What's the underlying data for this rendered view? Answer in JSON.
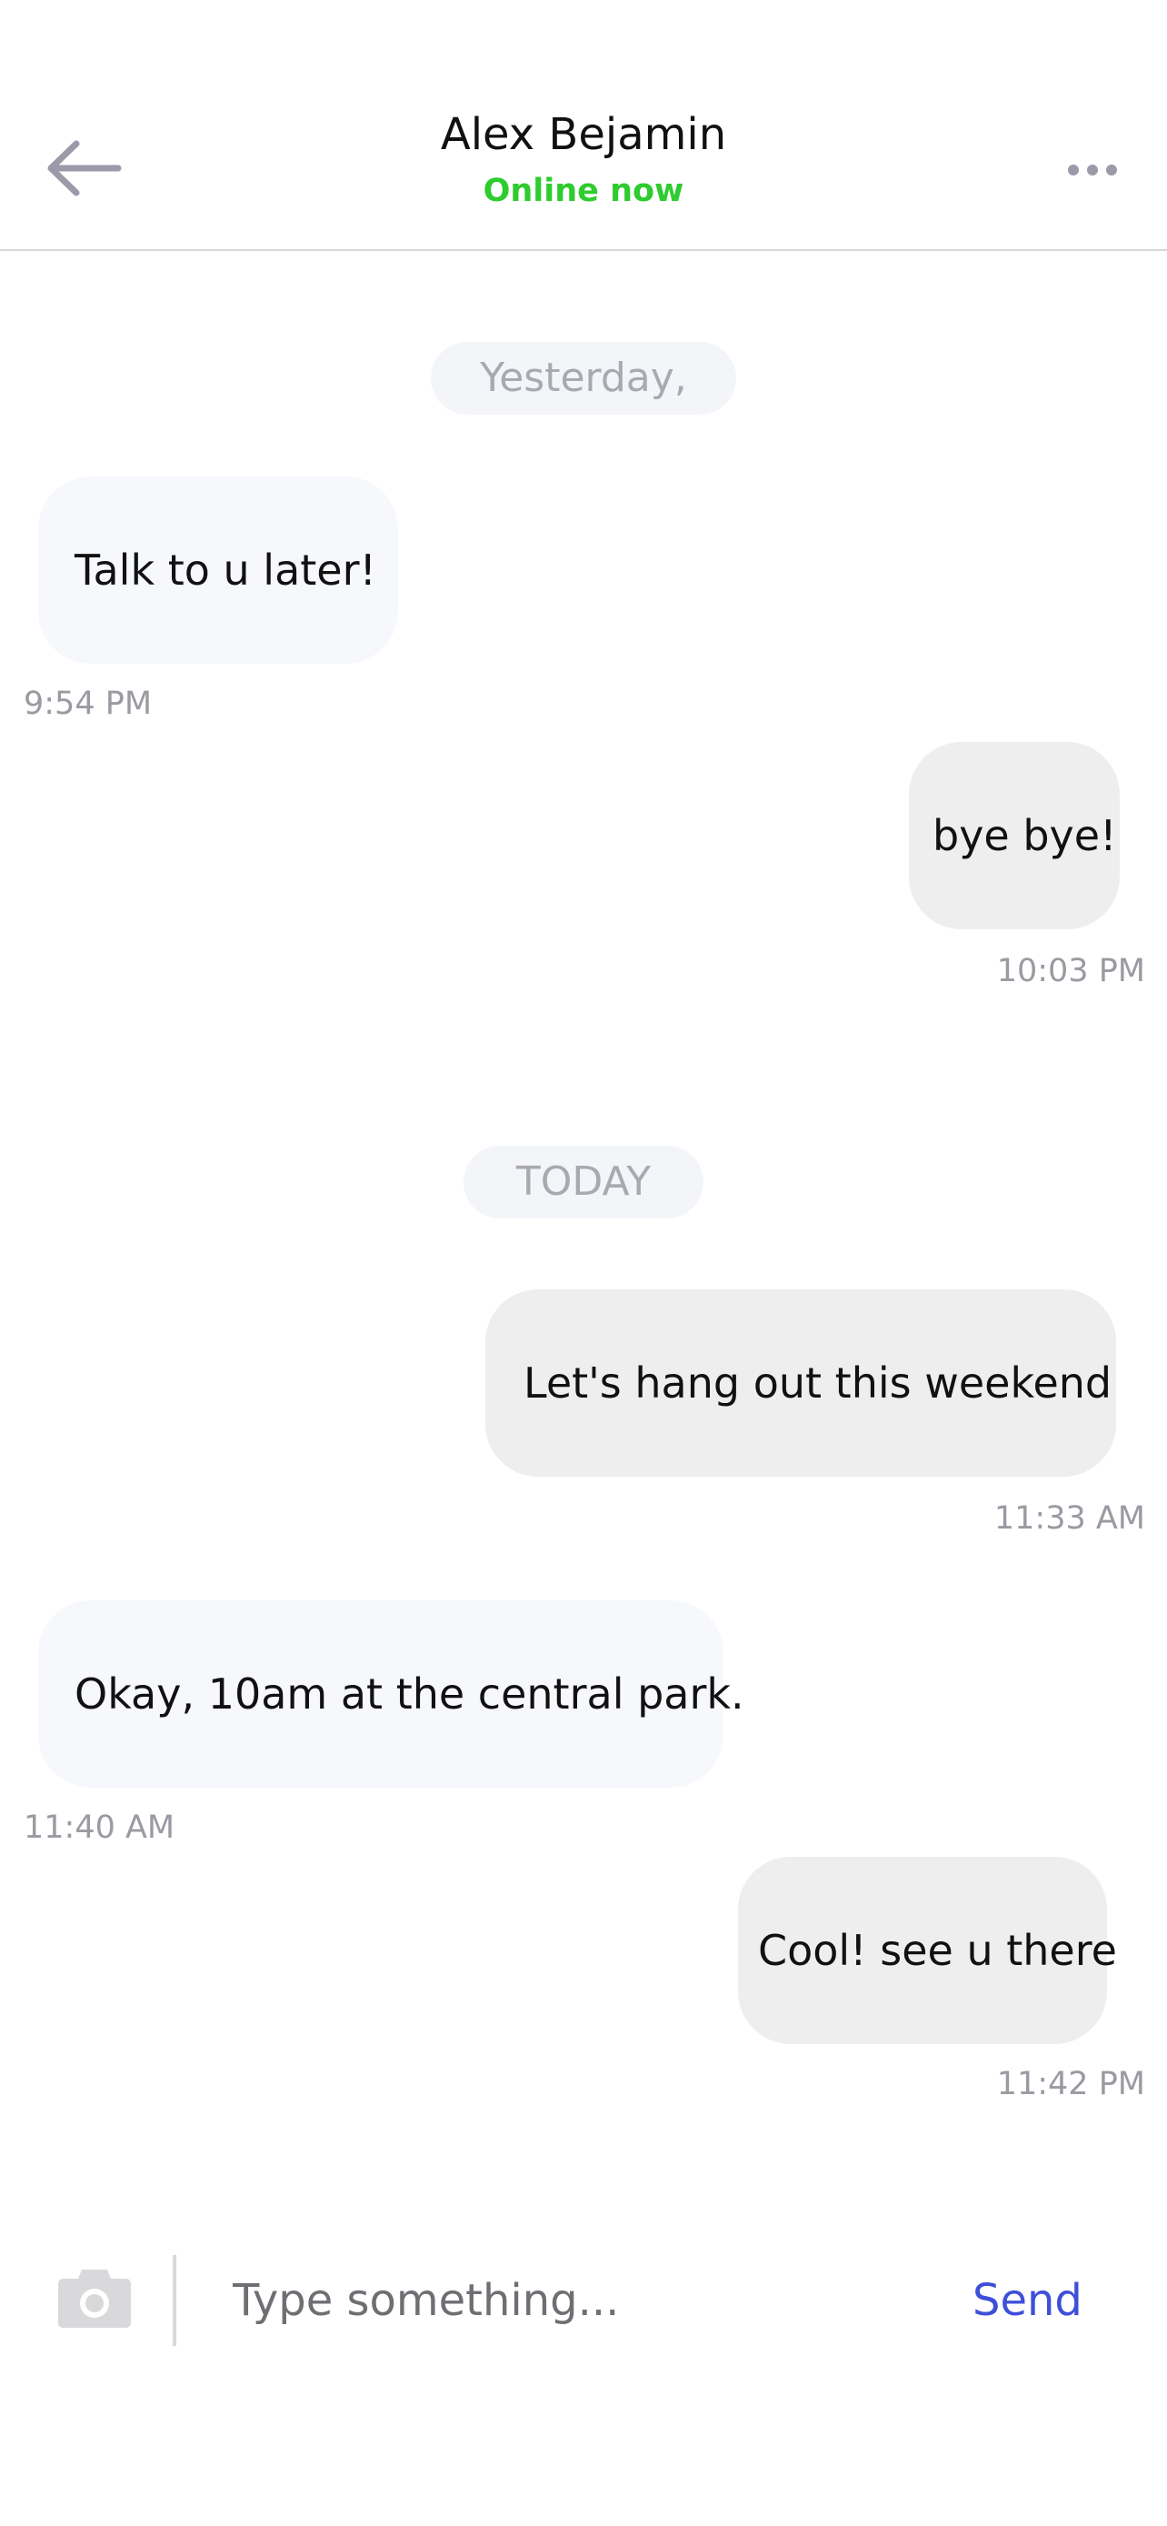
{
  "header": {
    "back_icon": "arrow-left-icon",
    "title": "Alex Bejamin",
    "status": "Online now",
    "status_color": "#2ecc2e",
    "more_icon": "more-horizontal-icon"
  },
  "thread": {
    "groups": [
      {
        "label": "Yesterday,",
        "messages": [
          {
            "direction": "incoming",
            "text": "Talk to u later!",
            "time": "9:54 PM"
          },
          {
            "direction": "outgoing",
            "text": "bye bye!",
            "time": "10:03 PM"
          }
        ]
      },
      {
        "label": "TODAY",
        "messages": [
          {
            "direction": "outgoing",
            "text": "Let's hang out this weekend",
            "time": "11:33 AM"
          },
          {
            "direction": "incoming",
            "text": "Okay, 10am at the central park.",
            "time": "11:40 AM"
          },
          {
            "direction": "outgoing",
            "text": "Cool! see u there",
            "time": "11:42 PM"
          }
        ]
      }
    ]
  },
  "composer": {
    "camera_icon": "camera-icon",
    "placeholder": "Type something...",
    "value": "",
    "send_label": "Send",
    "send_color": "#3e4fd8"
  }
}
